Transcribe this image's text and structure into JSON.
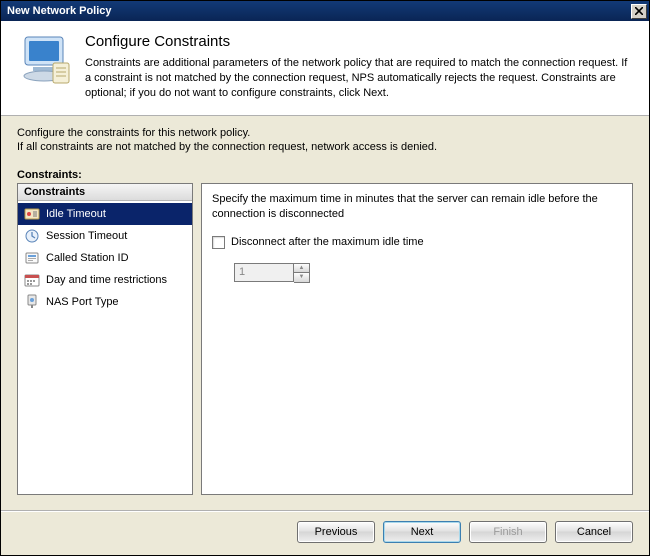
{
  "window": {
    "title": "New Network Policy"
  },
  "header": {
    "heading": "Configure Constraints",
    "description": "Constraints are additional parameters of the network policy that are required to match the connection request. If a constraint is not matched by the connection request, NPS automatically rejects the request. Constraints are optional; if you do not want to configure constraints, click Next."
  },
  "intro": {
    "line1": "Configure the constraints for this network policy.",
    "line2": "If all constraints are not matched by the connection request, network access is denied."
  },
  "left": {
    "label": "Constraints:",
    "header": "Constraints",
    "items": [
      {
        "label": "Idle Timeout",
        "selected": true
      },
      {
        "label": "Session Timeout",
        "selected": false
      },
      {
        "label": "Called Station ID",
        "selected": false
      },
      {
        "label": "Day and time restrictions",
        "selected": false
      },
      {
        "label": "NAS Port Type",
        "selected": false
      }
    ]
  },
  "right": {
    "description": "Specify the maximum time in minutes that the server can remain idle before the connection is disconnected",
    "checkbox_label": "Disconnect after the maximum idle time",
    "spinner_value": "1"
  },
  "buttons": {
    "previous": "Previous",
    "next": "Next",
    "finish": "Finish",
    "cancel": "Cancel"
  }
}
